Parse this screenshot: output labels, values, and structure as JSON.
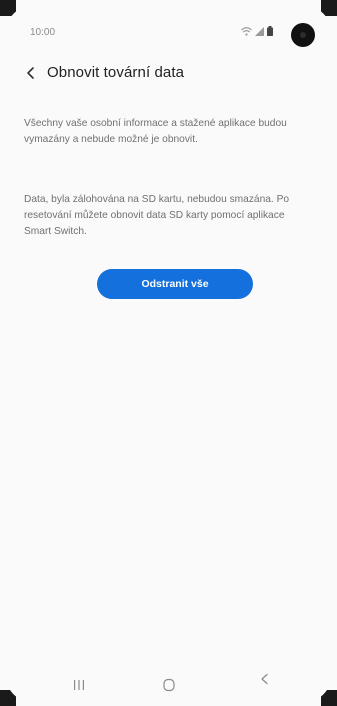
{
  "status_bar": {
    "time": "10:00",
    "icons": [
      "wifi-icon",
      "signal-icon",
      "battery-icon"
    ]
  },
  "header": {
    "title": "Obnovit tovární data",
    "back_icon": "chevron-left-icon"
  },
  "content": {
    "paragraph_1": "Všechny vaše osobní informace a stažené aplikace budou vymazány a nebude možné je obnovit.",
    "paragraph_2": "Data, byla zálohována na SD kartu, nebudou smazána. Po resetování můžete obnovit data SD karty pomocí aplikace Smart Switch."
  },
  "action": {
    "button_label": "Odstranit vše",
    "button_color": "#1470dc"
  },
  "nav_bar": {
    "icons": [
      "recent-apps-icon",
      "home-icon",
      "back-icon"
    ]
  }
}
